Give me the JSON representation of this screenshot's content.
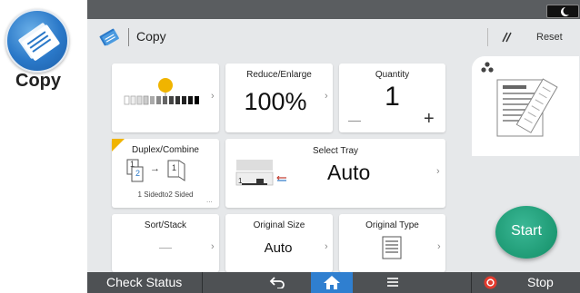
{
  "app": {
    "label": "Copy"
  },
  "header": {
    "title": "Copy",
    "reset_label": "Reset"
  },
  "tiles": {
    "density": {
      "title": ""
    },
    "reduce_enlarge": {
      "title": "Reduce/Enlarge",
      "value": "100%"
    },
    "quantity": {
      "title": "Quantity",
      "value": "1",
      "minus": "—",
      "plus": "+"
    },
    "duplex": {
      "title": "Duplex/Combine",
      "page1": "1",
      "page2": "2",
      "result_page": "1",
      "caption": "1 Sidedto2 Sided",
      "more": "..."
    },
    "select_tray": {
      "title": "Select Tray",
      "value": "Auto",
      "tray_number": "1"
    },
    "sort_stack": {
      "title": "Sort/Stack",
      "value": "—"
    },
    "original_size": {
      "title": "Original Size",
      "value": "Auto"
    },
    "original_type": {
      "title": "Original Type"
    }
  },
  "start": {
    "label": "Start"
  },
  "bottom_bar": {
    "check_status": "Check Status",
    "stop": "Stop"
  },
  "colors": {
    "start_green": "#1e9a74",
    "accent_yellow": "#f0b400",
    "app_blue": "#2a78c8"
  }
}
